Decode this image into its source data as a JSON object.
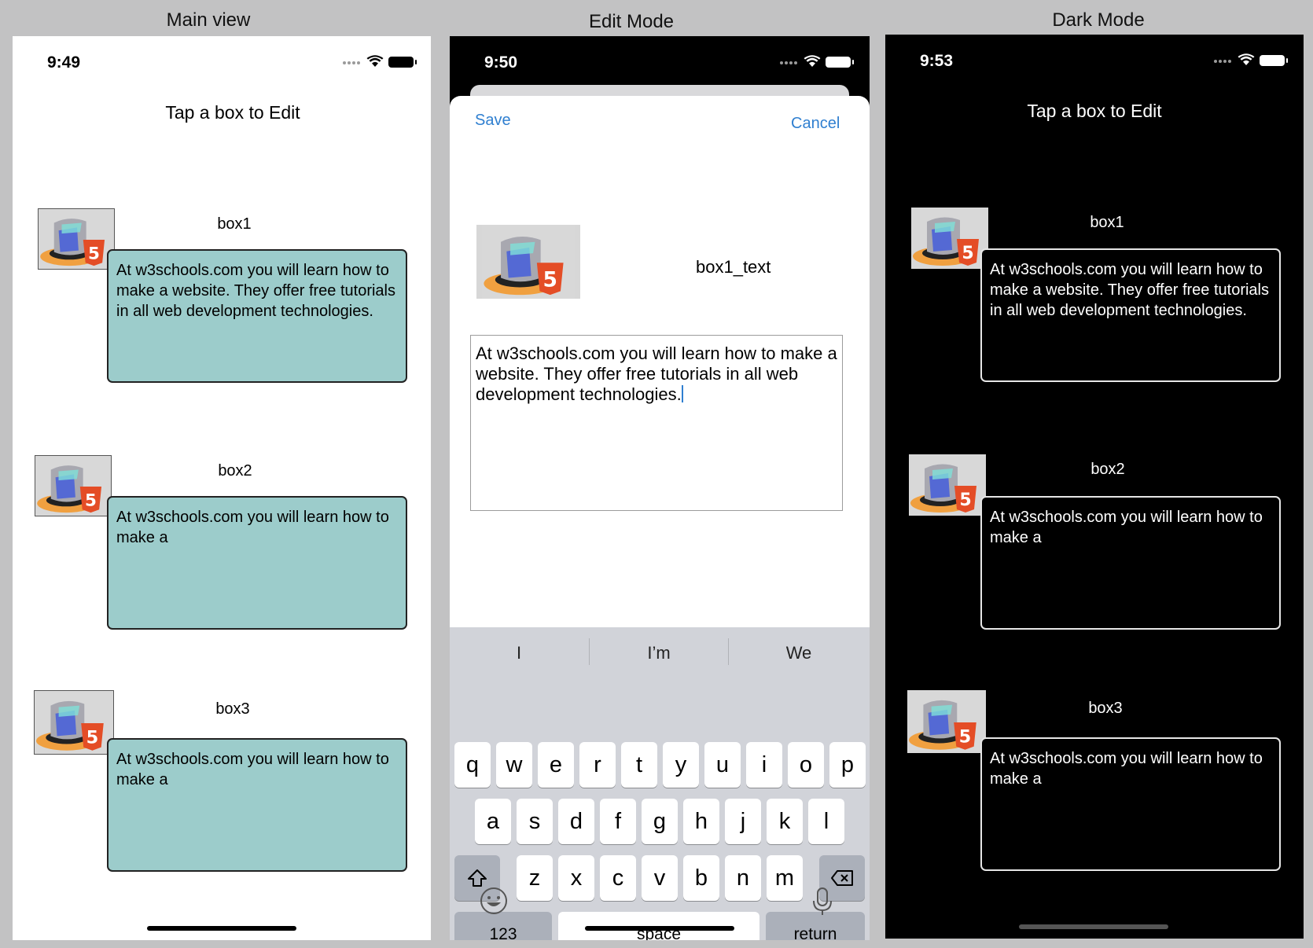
{
  "captions": {
    "main": "Main view",
    "edit": "Edit Mode",
    "dark": "Dark Mode"
  },
  "main_view": {
    "time": "9:49",
    "title": "Tap a box to Edit",
    "boxes": [
      {
        "label": "box1",
        "text": "At w3schools.com you will learn how to make a website. They offer free tutorials in all web development technologies."
      },
      {
        "label": "box2",
        "text": "At w3schools.com you will learn how to make a"
      },
      {
        "label": "box3",
        "text": "At w3schools.com you will learn how to make a"
      }
    ]
  },
  "edit_view": {
    "time": "9:50",
    "save_label": "Save",
    "cancel_label": "Cancel",
    "field_label": "box1_text",
    "textarea_value": "At w3schools.com you will learn how to make a website. They offer free tutorials in all web development technologies.",
    "suggestions": [
      "I",
      "I’m",
      "We"
    ],
    "keys": {
      "row1": [
        "q",
        "w",
        "e",
        "r",
        "t",
        "y",
        "u",
        "i",
        "o",
        "p"
      ],
      "row2": [
        "a",
        "s",
        "d",
        "f",
        "g",
        "h",
        "j",
        "k",
        "l"
      ],
      "row3": [
        "z",
        "x",
        "c",
        "v",
        "b",
        "n",
        "m"
      ],
      "numbers_label": "123",
      "space_label": "space",
      "return_label": "return"
    }
  },
  "dark_view": {
    "time": "9:53",
    "title": "Tap a box to Edit",
    "boxes": [
      {
        "label": "box1",
        "text": "At w3schools.com you will learn how to make a website. They offer free tutorials in all web development technologies."
      },
      {
        "label": "box2",
        "text": "At w3schools.com you will learn how to make a"
      },
      {
        "label": "box3",
        "text": "At w3schools.com you will learn how to make a"
      }
    ]
  },
  "colors": {
    "box_fill": "#9ccccb",
    "link_blue": "#2f7fd0",
    "keyboard_bg": "#d1d3d9"
  }
}
